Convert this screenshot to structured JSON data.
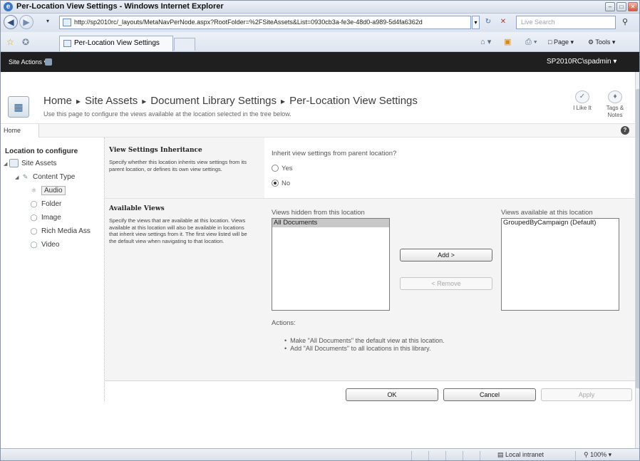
{
  "window": {
    "title": "Per-Location View Settings - Windows Internet Explorer",
    "address": "http://sp2010rc/_layouts/MetaNavPerNode.aspx?RootFolder=%2FSiteAssets&List=0930cb3a-fe3e-48d0-a989-5d4fa6362d",
    "search_placeholder": "Live Search",
    "tab_label": "Per-Location View Settings",
    "toolbar": {
      "page": "Page",
      "tools": "Tools"
    }
  },
  "ribbon": {
    "site_actions": "Site Actions",
    "user": "SP2010RC\\spadmin"
  },
  "header": {
    "breadcrumb": [
      "Home",
      "Site Assets",
      "Document Library Settings",
      "Per-Location View Settings"
    ],
    "description": "Use this page to configure the views available at the location selected in the tree below.",
    "i_like_it": "I Like It",
    "tags_notes_1": "Tags &",
    "tags_notes_2": "Notes"
  },
  "topnav": {
    "home": "Home"
  },
  "tree": {
    "title": "Location to configure",
    "site_assets": "Site Assets",
    "content_type": "Content Type",
    "items": [
      "Audio",
      "Folder",
      "Image",
      "Rich Media Ass",
      "Video"
    ]
  },
  "inheritance": {
    "title": "View Settings Inheritance",
    "description": "Specify whether this location inherits view settings from its parent location, or defines its own view settings.",
    "question": "Inherit view settings from parent location?",
    "yes": "Yes",
    "no": "No",
    "selected": "No"
  },
  "views": {
    "title": "Available Views",
    "description": "Specify the views that are available at this location. Views available at this location will also be available in locations that inherit view settings from it. The first view listed will be the default view when navigating to that location.",
    "hidden_label": "Views hidden from this location",
    "available_label": "Views available at this location",
    "hidden": [
      "All Documents"
    ],
    "available": [
      "GroupedByCampaign (Default)"
    ],
    "add": "Add >",
    "remove": "< Remove",
    "actions_label": "Actions:",
    "actions": [
      "Make \"All Documents\" the default view at this location.",
      "Add \"All Documents\" to all locations in this library."
    ]
  },
  "buttons": {
    "ok": "OK",
    "cancel": "Cancel",
    "apply": "Apply"
  },
  "status": {
    "zone": "Local intranet",
    "zoom": "100%"
  }
}
